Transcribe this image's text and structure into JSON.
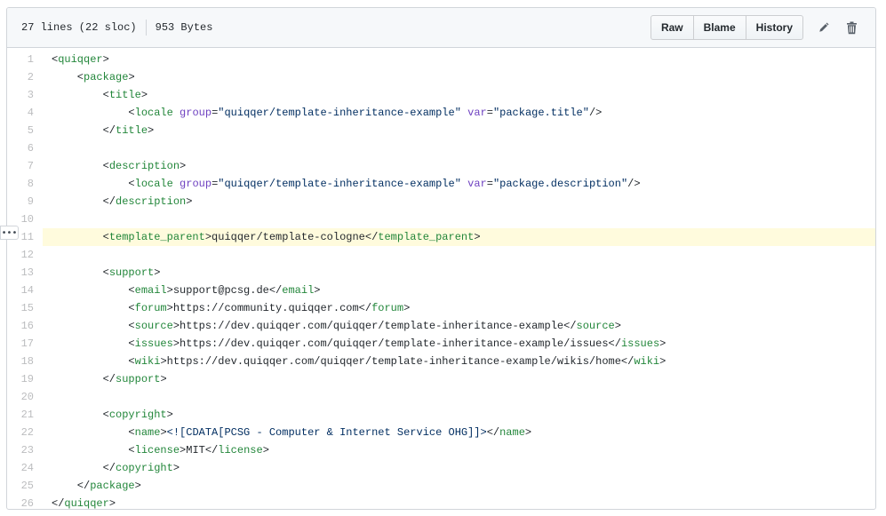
{
  "file_info": {
    "lines": "27 lines (22 sloc)",
    "size": "953 Bytes"
  },
  "actions": {
    "raw": "Raw",
    "blame": "Blame",
    "history": "History",
    "edit_icon": "pencil-icon",
    "delete_icon": "trash-icon"
  },
  "expander_label": "•••",
  "highlighted_line": 11,
  "lines": [
    {
      "n": "1",
      "indent": "",
      "t": [
        [
          "tg",
          "<quiqqer"
        ],
        [
          "",
          "> "
        ]
      ]
    },
    {
      "n": "2",
      "indent": "    ",
      "t": [
        [
          "tg",
          "<package"
        ],
        [
          "",
          ">"
        ]
      ]
    },
    {
      "n": "3",
      "indent": "        ",
      "t": [
        [
          "",
          ""
        ]
      ]
    },
    {
      "n": "4",
      "indent": "            ",
      "t": [
        [
          "",
          ""
        ]
      ]
    },
    {
      "n": "5",
      "indent": "        ",
      "t": [
        [
          "",
          ""
        ]
      ]
    },
    {
      "n": "6",
      "indent": "",
      "t": [
        [
          "",
          ""
        ]
      ]
    },
    {
      "n": "7",
      "indent": "        ",
      "t": [
        [
          "",
          ""
        ]
      ]
    },
    {
      "n": "8",
      "indent": "            ",
      "t": [
        [
          "",
          ""
        ]
      ]
    },
    {
      "n": "9",
      "indent": "        ",
      "t": [
        [
          "",
          ""
        ]
      ]
    },
    {
      "n": "10",
      "indent": "",
      "t": [
        [
          "",
          ""
        ]
      ]
    },
    {
      "n": "11",
      "indent": "        ",
      "t": [
        [
          "",
          ""
        ]
      ]
    },
    {
      "n": "12",
      "indent": "",
      "t": [
        [
          "",
          ""
        ]
      ]
    },
    {
      "n": "13",
      "indent": "        ",
      "t": [
        [
          "",
          ""
        ]
      ]
    },
    {
      "n": "14",
      "indent": "            ",
      "t": [
        [
          "",
          ""
        ]
      ]
    },
    {
      "n": "15",
      "indent": "            ",
      "t": [
        [
          "",
          ""
        ]
      ]
    },
    {
      "n": "16",
      "indent": "            ",
      "t": [
        [
          "",
          ""
        ]
      ]
    },
    {
      "n": "17",
      "indent": "            ",
      "t": [
        [
          "",
          ""
        ]
      ]
    },
    {
      "n": "18",
      "indent": "            ",
      "t": [
        [
          "",
          ""
        ]
      ]
    },
    {
      "n": "19",
      "indent": "        ",
      "t": [
        [
          "",
          ""
        ]
      ]
    },
    {
      "n": "20",
      "indent": "",
      "t": [
        [
          "",
          ""
        ]
      ]
    },
    {
      "n": "21",
      "indent": "        ",
      "t": [
        [
          "",
          ""
        ]
      ]
    },
    {
      "n": "22",
      "indent": "            ",
      "t": [
        [
          "",
          ""
        ]
      ]
    },
    {
      "n": "23",
      "indent": "            ",
      "t": [
        [
          "",
          ""
        ]
      ]
    },
    {
      "n": "24",
      "indent": "        ",
      "t": [
        [
          "",
          ""
        ]
      ]
    },
    {
      "n": "25",
      "indent": "    ",
      "t": [
        [
          "",
          ""
        ]
      ]
    },
    {
      "n": "26",
      "indent": "",
      "t": [
        [
          "",
          ""
        ]
      ]
    }
  ],
  "code": [
    [
      [
        "",
        "<"
      ],
      [
        "tg",
        "quiqqer"
      ],
      [
        "",
        ">"
      ]
    ],
    [
      [
        "",
        "    <"
      ],
      [
        "tg",
        "package"
      ],
      [
        "",
        ">"
      ]
    ],
    [
      [
        "",
        "        <"
      ],
      [
        "tg",
        "title"
      ],
      [
        "",
        ">"
      ]
    ],
    [
      [
        "",
        "            <"
      ],
      [
        "tg",
        "locale"
      ],
      [
        "",
        ""
      ],
      [
        "at",
        " group"
      ],
      [
        "",
        "="
      ],
      [
        "sv",
        "\"quiqqer/template-inheritance-example\""
      ],
      [
        "at",
        " var"
      ],
      [
        "",
        "="
      ],
      [
        "sv",
        "\"package.title\""
      ],
      [
        "",
        "/>"
      ]
    ],
    [
      [
        "",
        "        </"
      ],
      [
        "tg",
        "title"
      ],
      [
        "",
        ">"
      ]
    ],
    [
      [
        "",
        ""
      ]
    ],
    [
      [
        "",
        "        <"
      ],
      [
        "tg",
        "description"
      ],
      [
        "",
        ">"
      ]
    ],
    [
      [
        "",
        "            <"
      ],
      [
        "tg",
        "locale"
      ],
      [
        "at",
        " group"
      ],
      [
        "",
        "="
      ],
      [
        "sv",
        "\"quiqqer/template-inheritance-example\""
      ],
      [
        "at",
        " var"
      ],
      [
        "",
        "="
      ],
      [
        "sv",
        "\"package.description\""
      ],
      [
        "",
        "/>"
      ]
    ],
    [
      [
        "",
        "        </"
      ],
      [
        "tg",
        "description"
      ],
      [
        "",
        ">"
      ]
    ],
    [
      [
        "",
        ""
      ]
    ],
    [
      [
        "",
        "        <"
      ],
      [
        "tg",
        "template_parent"
      ],
      [
        "",
        ">quiqqer/template-cologne</"
      ],
      [
        "tg",
        "template_parent"
      ],
      [
        "",
        ">"
      ]
    ],
    [
      [
        "",
        ""
      ]
    ],
    [
      [
        "",
        "        <"
      ],
      [
        "tg",
        "support"
      ],
      [
        "",
        ">"
      ]
    ],
    [
      [
        "",
        "            <"
      ],
      [
        "tg",
        "email"
      ],
      [
        "",
        ">support@pcsg.de</"
      ],
      [
        "tg",
        "email"
      ],
      [
        "",
        ">"
      ]
    ],
    [
      [
        "",
        "            <"
      ],
      [
        "tg",
        "forum"
      ],
      [
        "",
        ">https://community.quiqqer.com</"
      ],
      [
        "tg",
        "forum"
      ],
      [
        "",
        ">"
      ]
    ],
    [
      [
        "",
        "            <"
      ],
      [
        "tg",
        "source"
      ],
      [
        "",
        ">https://dev.quiqqer.com/quiqqer/template-inheritance-example</"
      ],
      [
        "tg",
        "source"
      ],
      [
        "",
        ">"
      ]
    ],
    [
      [
        "",
        "            <"
      ],
      [
        "tg",
        "issues"
      ],
      [
        "",
        ">https://dev.quiqqer.com/quiqqer/template-inheritance-example/issues</"
      ],
      [
        "tg",
        "issues"
      ],
      [
        "",
        ">"
      ]
    ],
    [
      [
        "",
        "            <"
      ],
      [
        "tg",
        "wiki"
      ],
      [
        "",
        ">https://dev.quiqqer.com/quiqqer/template-inheritance-example/wikis/home</"
      ],
      [
        "tg",
        "wiki"
      ],
      [
        "",
        ">"
      ]
    ],
    [
      [
        "",
        "        </"
      ],
      [
        "tg",
        "support"
      ],
      [
        "",
        ">"
      ]
    ],
    [
      [
        "",
        ""
      ]
    ],
    [
      [
        "",
        "        <"
      ],
      [
        "tg",
        "copyright"
      ],
      [
        "",
        ">"
      ]
    ],
    [
      [
        "",
        "            <"
      ],
      [
        "tg",
        "name"
      ],
      [
        "",
        ">"
      ],
      [
        "sv",
        "<![CDATA[PCSG - Computer & Internet Service OHG]]>"
      ],
      [
        "",
        "</"
      ],
      [
        "tg",
        "name"
      ],
      [
        "",
        ">"
      ]
    ],
    [
      [
        "",
        "            <"
      ],
      [
        "tg",
        "license"
      ],
      [
        "",
        ">MIT</"
      ],
      [
        "tg",
        "license"
      ],
      [
        "",
        ">"
      ]
    ],
    [
      [
        "",
        "        </"
      ],
      [
        "tg",
        "copyright"
      ],
      [
        "",
        ">"
      ]
    ],
    [
      [
        "",
        "    </"
      ],
      [
        "tg",
        "package"
      ],
      [
        "",
        ">"
      ]
    ],
    [
      [
        "",
        "</"
      ],
      [
        "tg",
        "quiqqer"
      ],
      [
        "",
        ">"
      ]
    ]
  ]
}
